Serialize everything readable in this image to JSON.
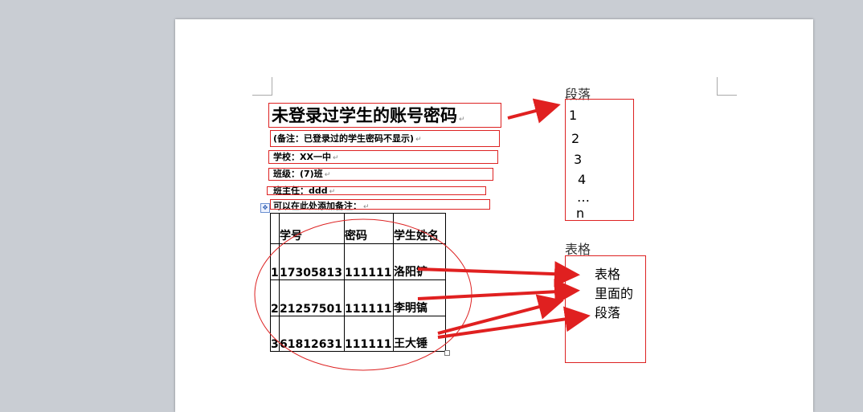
{
  "doc": {
    "title": "未登录过学生的账号密码",
    "note": "(备注：已登录过的学生密码不显示)",
    "school": "学校：XX一中",
    "class": "班级：(7)班",
    "teacher": "班主任：ddd",
    "remark": "可以在此处添加备注："
  },
  "table": {
    "headers": [
      "学号",
      "密码",
      "学生姓名"
    ],
    "rows": [
      {
        "no": "1",
        "id": "17305813",
        "pwd": "111111",
        "name": "洛阳铲"
      },
      {
        "no": "2",
        "id": "21257501",
        "pwd": "111111",
        "name": "李明镐"
      },
      {
        "no": "3",
        "id": "61812631",
        "pwd": "111111",
        "name": "王大锤"
      }
    ]
  },
  "annotations": {
    "paragraph_label": "段落",
    "paragraph_items": [
      "1",
      "2",
      "3",
      "4",
      "…",
      "n"
    ],
    "table_label": "表格",
    "table_paragraph_lines": [
      "表格",
      "里面的",
      "段落"
    ]
  },
  "colors": {
    "annotation": "#e02020",
    "page": "#ffffff",
    "workspace": "#c9cdd3"
  }
}
